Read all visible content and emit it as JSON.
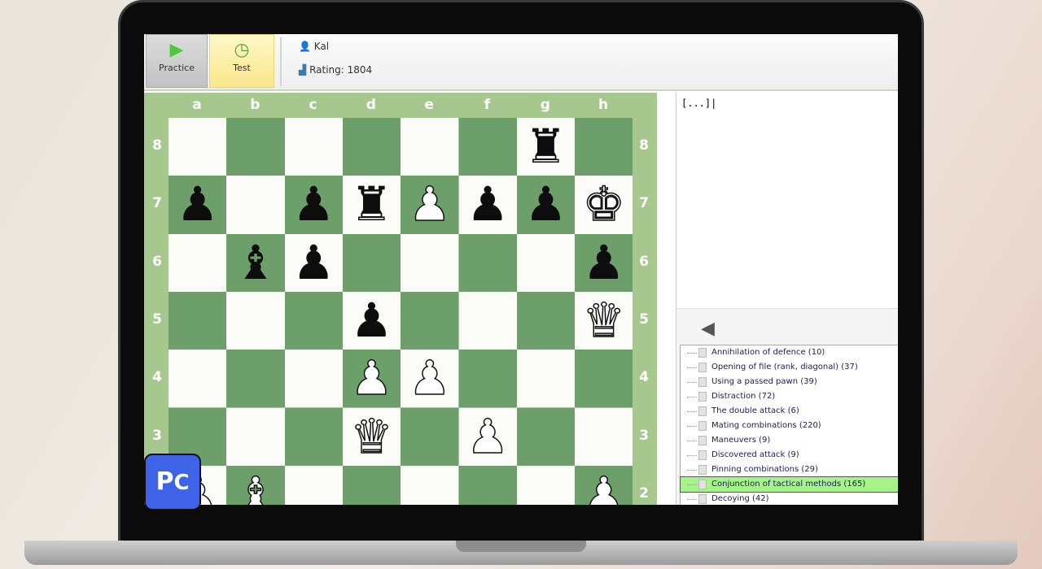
{
  "toolbar": {
    "practice_label": "Practice",
    "test_label": "Test",
    "user_name": "Kal",
    "rating": "Rating: 1804"
  },
  "board": {
    "files": [
      "a",
      "b",
      "c",
      "d",
      "e",
      "f",
      "g",
      "h"
    ],
    "ranks": [
      "8",
      "7",
      "6",
      "5",
      "4",
      "3",
      "2"
    ],
    "pieces": [
      {
        "sq": "g8",
        "glyph": "♜",
        "color": "b",
        "name": "black-rook"
      },
      {
        "sq": "a7",
        "glyph": "♟",
        "color": "b",
        "name": "black-pawn"
      },
      {
        "sq": "c7",
        "glyph": "♟",
        "color": "b",
        "name": "black-pawn"
      },
      {
        "sq": "d7",
        "glyph": "♜",
        "color": "b",
        "name": "black-rook"
      },
      {
        "sq": "e7",
        "glyph": "♟",
        "color": "w",
        "name": "white-pawn"
      },
      {
        "sq": "f7",
        "glyph": "♟",
        "color": "b",
        "name": "black-pawn"
      },
      {
        "sq": "g7",
        "glyph": "♟",
        "color": "b",
        "name": "black-pawn"
      },
      {
        "sq": "h7",
        "glyph": "♚",
        "color": "w",
        "name": "black-king"
      },
      {
        "sq": "b6",
        "glyph": "♝",
        "color": "b",
        "name": "black-bishop"
      },
      {
        "sq": "c6",
        "glyph": "♟",
        "color": "b",
        "name": "black-pawn"
      },
      {
        "sq": "h6",
        "glyph": "♟",
        "color": "b",
        "name": "black-pawn"
      },
      {
        "sq": "d5",
        "glyph": "♟",
        "color": "b",
        "name": "black-pawn"
      },
      {
        "sq": "h5",
        "glyph": "♛",
        "color": "w",
        "name": "black-queen"
      },
      {
        "sq": "d4",
        "glyph": "♟",
        "color": "w",
        "name": "white-pawn"
      },
      {
        "sq": "e4",
        "glyph": "♟",
        "color": "w",
        "name": "white-pawn"
      },
      {
        "sq": "d3",
        "glyph": "♛",
        "color": "w",
        "name": "white-queen"
      },
      {
        "sq": "f3",
        "glyph": "♟",
        "color": "w",
        "name": "white-pawn"
      },
      {
        "sq": "a2",
        "glyph": "♟",
        "color": "w",
        "name": "white-pawn"
      },
      {
        "sq": "b2",
        "glyph": "♝",
        "color": "w",
        "name": "white-bishop"
      },
      {
        "sq": "h2",
        "glyph": "♟",
        "color": "w",
        "name": "white-pawn"
      }
    ]
  },
  "notes": {
    "text": "[...]"
  },
  "tree": {
    "items": [
      {
        "label": "Annihilation of defence (10)"
      },
      {
        "label": "Opening of  file (rank, diagonal) (37)"
      },
      {
        "label": "Using a passed pawn (39)"
      },
      {
        "label": "Distraction (72)"
      },
      {
        "label": "The double attack (6)"
      },
      {
        "label": "Mating combinations (220)"
      },
      {
        "label": "Maneuvers (9)"
      },
      {
        "label": "Discovered attack (9)"
      },
      {
        "label": "Pinning combinations (29)"
      },
      {
        "label": "Conjunction of tactical methods (165)",
        "selected": true
      },
      {
        "label": "Decoying (42)"
      }
    ]
  },
  "logo": {
    "text": "PC"
  }
}
